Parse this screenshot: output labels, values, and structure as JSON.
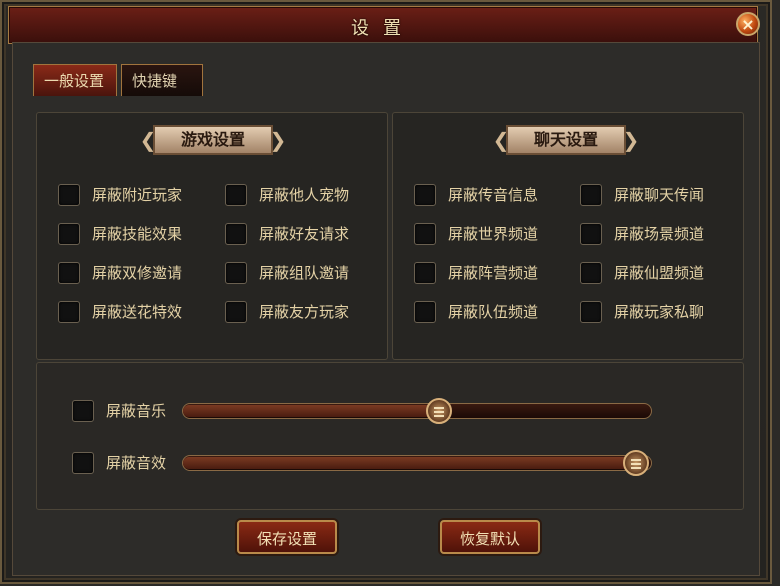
{
  "window": {
    "title": "设置",
    "close_label": "×"
  },
  "tabs": [
    {
      "label": "一般设置",
      "active": true
    },
    {
      "label": "快捷键",
      "active": false
    }
  ],
  "game_settings": {
    "header": "游戏设置",
    "options": [
      {
        "label": "屏蔽附近玩家",
        "checked": false
      },
      {
        "label": "屏蔽他人宠物",
        "checked": false
      },
      {
        "label": "屏蔽技能效果",
        "checked": false
      },
      {
        "label": "屏蔽好友请求",
        "checked": false
      },
      {
        "label": "屏蔽双修邀请",
        "checked": false
      },
      {
        "label": "屏蔽组队邀请",
        "checked": false
      },
      {
        "label": "屏蔽送花特效",
        "checked": false
      },
      {
        "label": "屏蔽友方玩家",
        "checked": false
      }
    ]
  },
  "chat_settings": {
    "header": "聊天设置",
    "options": [
      {
        "label": "屏蔽传音信息",
        "checked": false
      },
      {
        "label": "屏蔽聊天传闻",
        "checked": false
      },
      {
        "label": "屏蔽世界频道",
        "checked": false
      },
      {
        "label": "屏蔽场景频道",
        "checked": false
      },
      {
        "label": "屏蔽阵营频道",
        "checked": false
      },
      {
        "label": "屏蔽仙盟频道",
        "checked": false
      },
      {
        "label": "屏蔽队伍频道",
        "checked": false
      },
      {
        "label": "屏蔽玩家私聊",
        "checked": false
      }
    ]
  },
  "sound": {
    "music": {
      "label": "屏蔽音乐",
      "checked": false,
      "level": 0.55
    },
    "effects": {
      "label": "屏蔽音效",
      "checked": false,
      "level": 1.0
    }
  },
  "buttons": {
    "save": "保存设置",
    "restore": "恢复默认"
  },
  "colors": {
    "title_red": "#6b1f16",
    "text_gold": "#e4d2a6",
    "border_gold": "#a1743d"
  }
}
